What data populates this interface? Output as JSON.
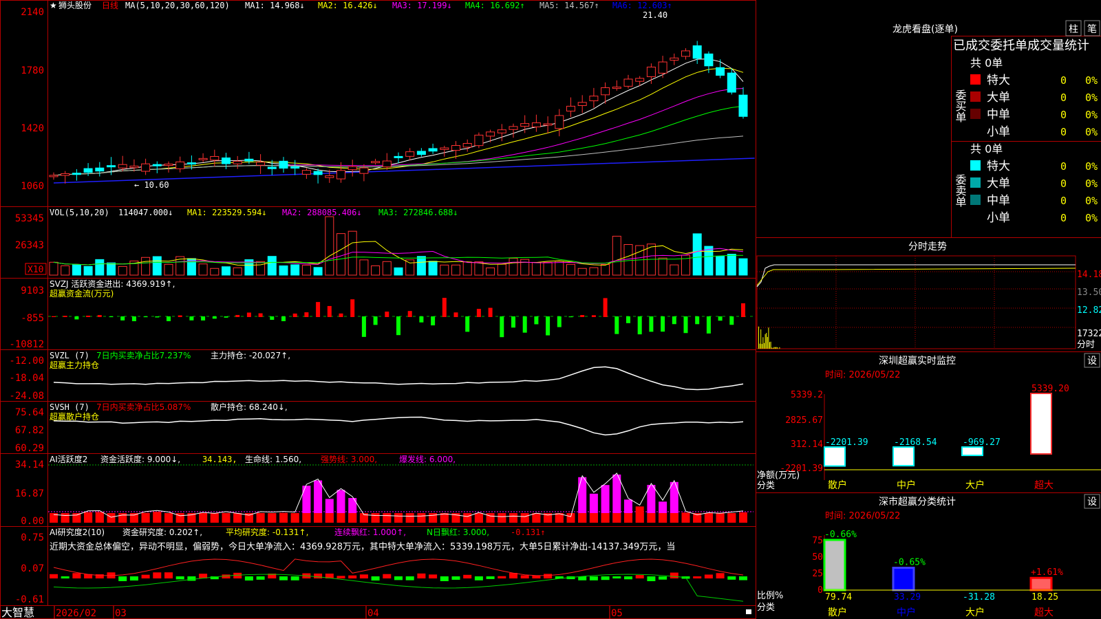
{
  "stock": {
    "name": "狮头股份",
    "period": "日线",
    "star": "★"
  },
  "main_panel": {
    "ma_label": "MA(5,10,20,30,60,120)",
    "ma_values": [
      {
        "text": "MA1: 14.968↓",
        "color": "#ffffff"
      },
      {
        "text": "MA2: 16.426↓",
        "color": "#ffff00"
      },
      {
        "text": "MA3: 17.199↓",
        "color": "#ff00ff"
      },
      {
        "text": "MA4: 16.692↑",
        "color": "#00ff00"
      },
      {
        "text": "MA5: 14.567↑",
        "color": "#c0c0c0"
      },
      {
        "text": "MA6: 12.603↑",
        "color": "#0000ff"
      }
    ],
    "y_ticks": [
      "2140",
      "1780",
      "1420",
      "1060"
    ],
    "high_label": "21.40",
    "low_label": "← 10.60"
  },
  "vol_panel": {
    "label": "VOL(5,10,20)",
    "value": "114047.000↓",
    "ma": [
      {
        "text": "MA1: 223529.594↓",
        "color": "#ffff00"
      },
      {
        "text": "MA2: 288085.406↓",
        "color": "#ff00ff"
      },
      {
        "text": "MA3: 272846.688↓",
        "color": "#00ff00"
      }
    ],
    "y_ticks": [
      "53345",
      "26343"
    ],
    "unit": "X10"
  },
  "svzj_panel": {
    "title": "SVZJ  活跃资金进出: 4369.919↑,",
    "subtitle": "超赢资金流(万元)",
    "y_ticks": [
      "9103",
      "-855",
      "-10812"
    ]
  },
  "svzl_panel": {
    "title": "SVZL (7)",
    "t2": "7日内买卖净占比7.237%",
    "t3": "主力持仓: -20.027↑,",
    "subtitle": "超赢主力持仓",
    "y_ticks": [
      "-12.00",
      "-18.04",
      "-24.08"
    ]
  },
  "svsh_panel": {
    "title": "SVSH (7)",
    "t2": "7日内买卖净占比5.087%",
    "t3": "散户持仓: 68.240↓,",
    "subtitle": "超赢散户持仓",
    "y_ticks": [
      "75.64",
      "67.82",
      "60.29"
    ]
  },
  "ai_active_panel": {
    "title": "AI活跃度2",
    "t1": "资金活跃度: 9.000↓,",
    "t2": "34.143,",
    "t3": "生命线: 1.560,",
    "t4": "强势线: 3.000,",
    "t5": "爆发线: 6.000,",
    "y_ticks": [
      "34.14",
      "16.87",
      "0.00"
    ]
  },
  "ai_research_panel": {
    "title": "AI研究度2(10)",
    "t1": "资金研究度: 0.202↑,",
    "t2": "平均研究度: -0.131↑,",
    "t3": "连续飘红: 1.000↑,",
    "t4": "N日飘红: 3.000,",
    "t5": "-0.131↑",
    "comment": "近期大资金总体偏空，异动不明显，偏弱势，今日大单净流入：4369.928万元，其中特大单净流入：5339.198万元，大单5日累计净出-14137.349万元，当",
    "y_ticks": [
      "0.75",
      "0.07",
      "-0.61"
    ]
  },
  "x_axis": {
    "labels": [
      "2026/02",
      "03",
      "04",
      "05"
    ],
    "brand": "大智慧"
  },
  "longhu": {
    "title": "龙虎看盘(逐单)",
    "btn1": "柱",
    "btn2": "笔",
    "header": "已成交委托单成交量统计",
    "buy_label": "委买单",
    "sell_label": "委卖单",
    "buy_total": "共 0单",
    "sell_total": "共 0单",
    "buy_rows": [
      {
        "name": "特大",
        "count": "0",
        "pct": "0%",
        "color": "#ff0000"
      },
      {
        "name": "大单",
        "count": "0",
        "pct": "0%",
        "color": "#aa0000"
      },
      {
        "name": "中单",
        "count": "0",
        "pct": "0%",
        "color": "#660000"
      },
      {
        "name": "小单",
        "count": "0",
        "pct": "0%",
        "color": ""
      }
    ],
    "sell_rows": [
      {
        "name": "特大",
        "count": "0",
        "pct": "0%",
        "color": "#00ffff"
      },
      {
        "name": "大单",
        "count": "0",
        "pct": "0%",
        "color": "#00aaaa"
      },
      {
        "name": "中单",
        "count": "0",
        "pct": "0%",
        "color": "#007777"
      },
      {
        "name": "小单",
        "count": "0",
        "pct": "0%",
        "color": ""
      }
    ]
  },
  "intraday": {
    "title": "分时走势",
    "y_ticks": [
      "14.18",
      "13.50",
      "12.82"
    ],
    "vol_label": "17322",
    "fen_label": "分时"
  },
  "sz_monitor": {
    "title": "深圳超赢实时监控",
    "settings": "设",
    "time": "时间: 2026/05/22",
    "y_ticks": [
      "5339.2",
      "2825.67",
      "312.14",
      "-2201.39"
    ],
    "ylabel": "净额(万元)",
    "xlabel": "分类",
    "chart_data": {
      "type": "bar",
      "categories": [
        "散户",
        "中户",
        "大户",
        "超大"
      ],
      "values": [
        -2201.39,
        -2168.54,
        -969.27,
        5339.2
      ],
      "ylim": [
        -2201.39,
        5339.2
      ]
    }
  },
  "sz_class": {
    "title": "深市超赢分类统计",
    "settings": "设",
    "time": "时间: 2026/05/22",
    "y_ticks": [
      "75",
      "50",
      "25",
      "0"
    ],
    "ylabel": "比例%",
    "xlabel": "分类",
    "chart_data": {
      "type": "bar",
      "categories": [
        "散户",
        "中户",
        "大户",
        "超大"
      ],
      "values": [
        79.74,
        33.29,
        -31.28,
        18.25
      ],
      "changes": [
        "-0.66%",
        "-0.65%",
        "",
        "+1.61%"
      ],
      "ylim": [
        0,
        75
      ]
    }
  },
  "colors": {
    "up": "#ff0000",
    "down": "#00ffff",
    "grid": "#aa0000",
    "bg": "#000000"
  }
}
